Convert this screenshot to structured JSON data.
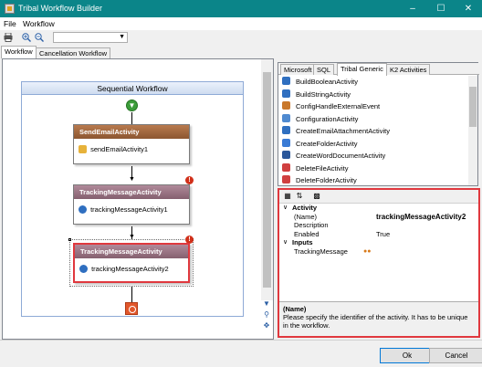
{
  "window": {
    "title": "Tribal Workflow Builder"
  },
  "menu": [
    "File",
    "Workflow"
  ],
  "toolbar": {
    "combo_value": ""
  },
  "document_tabs": [
    "Workflow",
    "Cancellation Workflow"
  ],
  "designer": {
    "header": "Sequential Workflow",
    "activities": [
      {
        "type": "SendEmailActivity",
        "name": "sendEmailActivity1"
      },
      {
        "type": "TrackingMessageActivity",
        "name": "trackingMessageActivity1"
      },
      {
        "type": "TrackingMessageActivity",
        "name": "trackingMessageActivity2"
      }
    ],
    "error_badge": "!"
  },
  "toolbox": {
    "tabs": [
      "Microsoft",
      "SQL",
      "Tribal Generic",
      "K2 Activities"
    ],
    "items": [
      {
        "label": "BuildBooleanActivity",
        "icon": "blue-activity-icon",
        "color": "#2f6fc0"
      },
      {
        "label": "BuildStringActivity",
        "icon": "blue-activity-icon",
        "color": "#2f6fc0"
      },
      {
        "label": "ConfigHandleExternalEvent",
        "icon": "event-handler-icon",
        "color": "#c9782b"
      },
      {
        "label": "ConfigurationActivity",
        "icon": "config-gear-icon",
        "color": "#4f8ad0"
      },
      {
        "label": "CreateEmailAttachmentActivity",
        "icon": "blue-activity-icon",
        "color": "#2f6fc0"
      },
      {
        "label": "CreateFolderActivity",
        "icon": "folder-icon",
        "color": "#3a7bd5"
      },
      {
        "label": "CreateWordDocumentActivity",
        "icon": "word-document-icon",
        "color": "#2b579a"
      },
      {
        "label": "DeleteFileActivity",
        "icon": "delete-file-icon",
        "color": "#d04040"
      },
      {
        "label": "DeleteFolderActivity",
        "icon": "delete-folder-icon",
        "color": "#d04040"
      }
    ]
  },
  "properties": {
    "categories": [
      {
        "name": "Activity",
        "rows": [
          {
            "name": "(Name)",
            "value": "trackingMessageActivity2"
          },
          {
            "name": "Description",
            "value": ""
          },
          {
            "name": "Enabled",
            "value": "True"
          }
        ]
      },
      {
        "name": "Inputs",
        "rows": [
          {
            "name": "TrackingMessage",
            "value": ""
          }
        ]
      }
    ],
    "description_title": "(Name)",
    "description_text": "Please specify the identifier of the activity. It has to be unique in the workflow."
  },
  "buttons": {
    "ok": "Ok",
    "cancel": "Cancel"
  },
  "colors": {
    "titlebar": "#0b8589",
    "selection": "#e0383e"
  }
}
